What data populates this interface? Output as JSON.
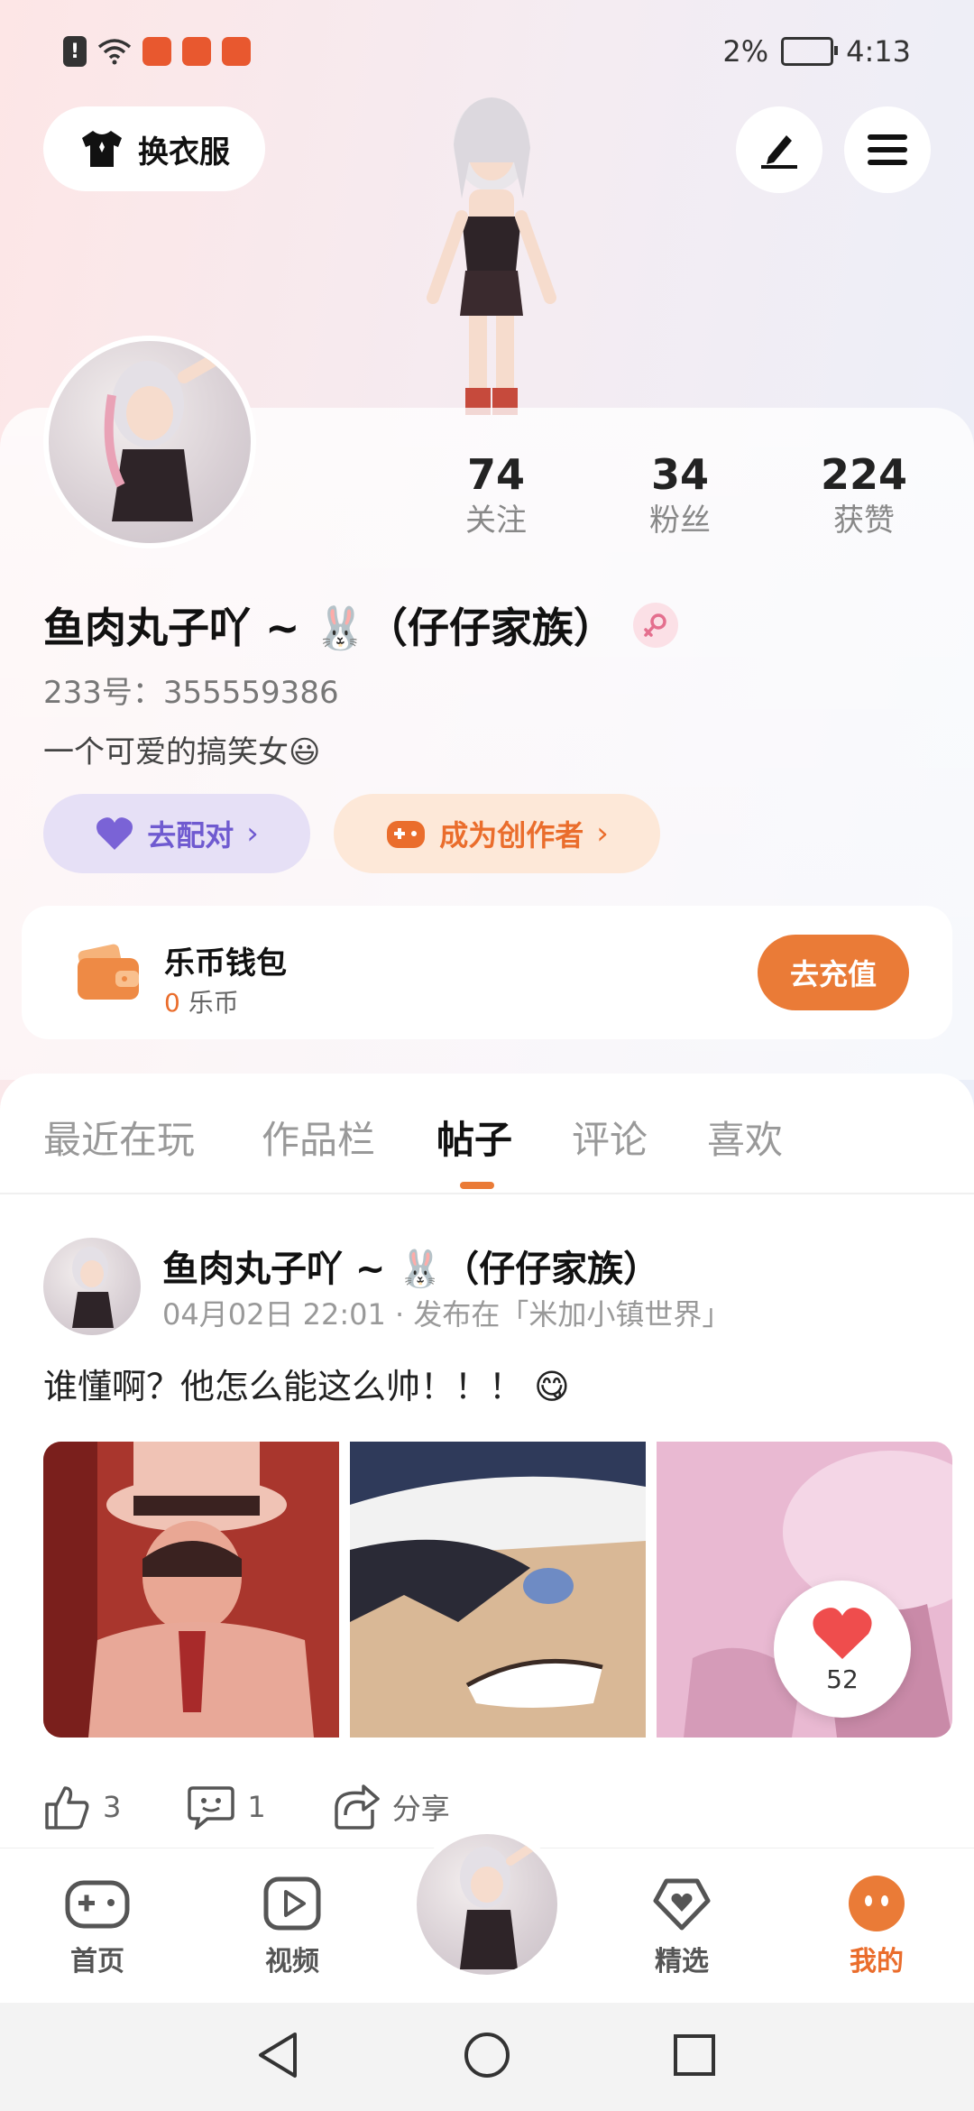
{
  "status_bar": {
    "battery": "2%",
    "time": "4:13"
  },
  "header": {
    "outfit_label": "换衣服"
  },
  "profile": {
    "stats": [
      {
        "value": "74",
        "label": "关注"
      },
      {
        "value": "34",
        "label": "粉丝"
      },
      {
        "value": "224",
        "label": "获赞"
      }
    ],
    "username": "鱼肉丸子吖 ~ 🐰（仔仔家族）",
    "uid": "233号：355559386",
    "bio": "一个可爱的搞笑女😃",
    "pair_label": "去配对",
    "creator_label": "成为创作者"
  },
  "wallet": {
    "title": "乐币钱包",
    "balance": "0",
    "unit": "乐币",
    "recharge_label": "去充值"
  },
  "tabs": [
    "最近在玩",
    "作品栏",
    "帖子",
    "评论",
    "喜欢"
  ],
  "active_tab": "帖子",
  "post": {
    "author": "鱼肉丸子吖 ~ 🐰（仔仔家族）",
    "meta": "04月02日 22:01 · 发布在「米加小镇世界」",
    "text": "谁懂啊？他怎么能这么帅！！！ 😋",
    "like_bubble_count": "52",
    "likes": "3",
    "comments": "1",
    "share_label": "分享"
  },
  "bottom_nav": [
    {
      "label": "首页",
      "icon": "gamepad-icon"
    },
    {
      "label": "视频",
      "icon": "play-icon"
    },
    {
      "label": "精选",
      "icon": "heart-shield-icon"
    },
    {
      "label": "我的",
      "icon": "face-icon"
    }
  ],
  "colors": {
    "accent": "#ea7b37",
    "purple": "#6f5ad0"
  }
}
